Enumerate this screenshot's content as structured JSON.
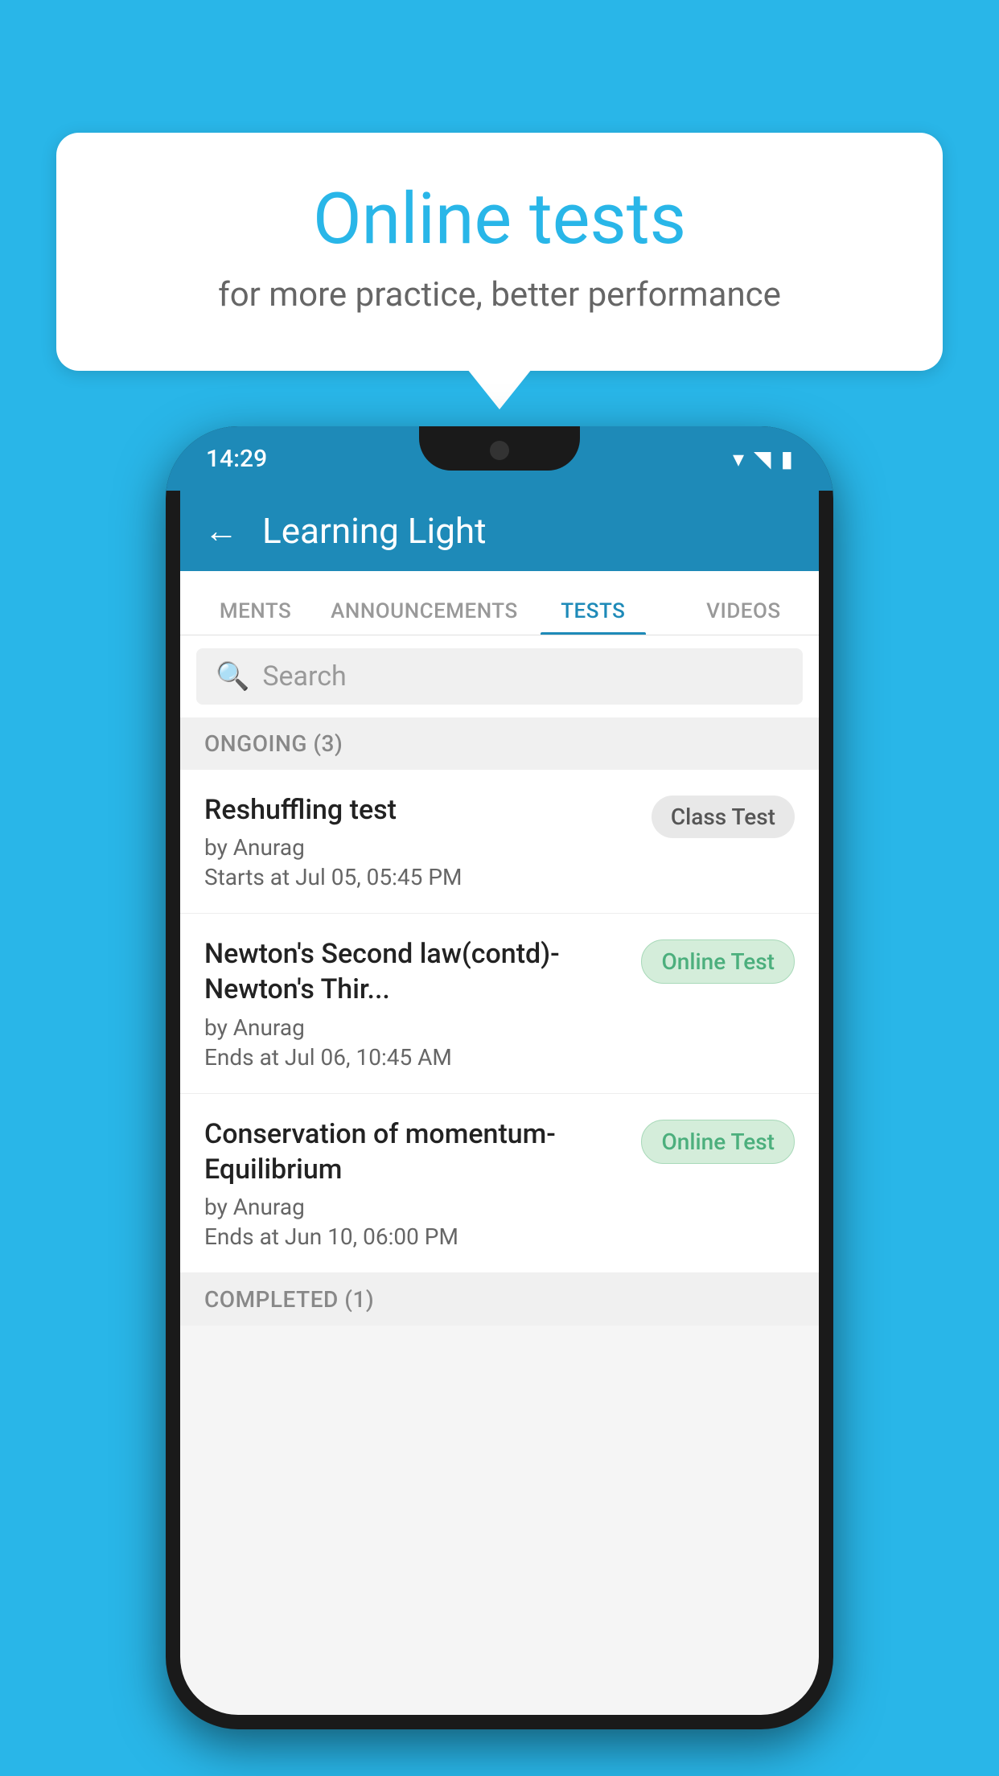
{
  "background_color": "#29b6e8",
  "bubble": {
    "title": "Online tests",
    "subtitle": "for more practice, better performance"
  },
  "phone": {
    "status_bar": {
      "time": "14:29",
      "icons": [
        "wifi",
        "signal",
        "battery"
      ]
    },
    "header": {
      "title": "Learning Light",
      "back_label": "←"
    },
    "tabs": [
      {
        "label": "MENTS",
        "active": false
      },
      {
        "label": "ANNOUNCEMENTS",
        "active": false
      },
      {
        "label": "TESTS",
        "active": true
      },
      {
        "label": "VIDEOS",
        "active": false
      }
    ],
    "search": {
      "placeholder": "Search"
    },
    "ongoing_section": {
      "label": "ONGOING (3)"
    },
    "tests": [
      {
        "name": "Reshuffling test",
        "by": "by Anurag",
        "time": "Starts at  Jul 05, 05:45 PM",
        "badge": "Class Test",
        "badge_type": "class"
      },
      {
        "name": "Newton's Second law(contd)-Newton's Thir...",
        "by": "by Anurag",
        "time": "Ends at  Jul 06, 10:45 AM",
        "badge": "Online Test",
        "badge_type": "online"
      },
      {
        "name": "Conservation of momentum-Equilibrium",
        "by": "by Anurag",
        "time": "Ends at  Jun 10, 06:00 PM",
        "badge": "Online Test",
        "badge_type": "online"
      }
    ],
    "completed_section": {
      "label": "COMPLETED (1)"
    }
  }
}
